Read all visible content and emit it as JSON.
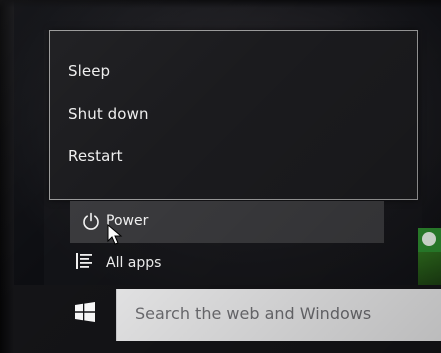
{
  "power_menu": {
    "items": [
      {
        "label": "Sleep"
      },
      {
        "label": "Shut down"
      },
      {
        "label": "Restart"
      }
    ]
  },
  "start_menu": {
    "power_label": "Power",
    "all_apps_label": "All apps"
  },
  "taskbar": {
    "search_placeholder": "Search the web and Windows"
  },
  "icons": {
    "power": "power-icon",
    "all_apps": "list-icon",
    "start": "windows-logo-icon",
    "cursor": "mouse-pointer-icon"
  },
  "colors": {
    "menu_background": "#1b1b1e",
    "menu_border": "#9a9a9a",
    "highlight": "#3a3a3d",
    "search_background": "#e9e9ea",
    "tile_green": "#2d8a2f"
  }
}
